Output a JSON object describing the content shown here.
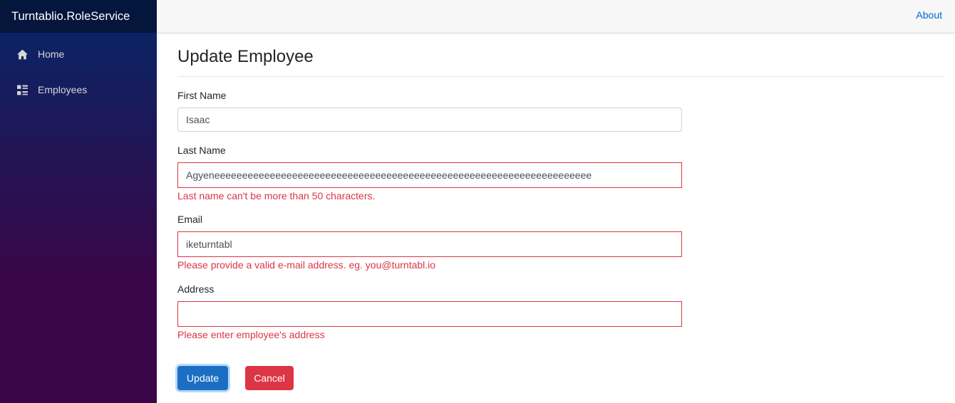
{
  "app": {
    "brand": "Turntablio.RoleService"
  },
  "sidebar": {
    "items": [
      {
        "label": "Home",
        "icon": "home-icon"
      },
      {
        "label": "Employees",
        "icon": "list-icon"
      }
    ]
  },
  "topbar": {
    "about_label": "About"
  },
  "page": {
    "title": "Update Employee"
  },
  "form": {
    "first_name": {
      "label": "First Name",
      "value": "Isaac"
    },
    "last_name": {
      "label": "Last Name",
      "value": "Agyeneeeeeeeeeeeeeeeeeeeeeeeeeeeeeeeeeeeeeeeeeeeeeeeeeeeeeeeeeeeeeeeeeeee",
      "error": "Last name can't be more than 50 characters."
    },
    "email": {
      "label": "Email",
      "value": "iketurntabl",
      "error": "Please provide a valid e-mail address. eg. you@turntabl.io"
    },
    "address": {
      "label": "Address",
      "value": "",
      "error": "Please enter employee's address"
    }
  },
  "actions": {
    "update_label": "Update",
    "cancel_label": "Cancel"
  },
  "colors": {
    "primary": "#1b6ec2",
    "danger": "#dc3545",
    "link": "#0366d6"
  }
}
